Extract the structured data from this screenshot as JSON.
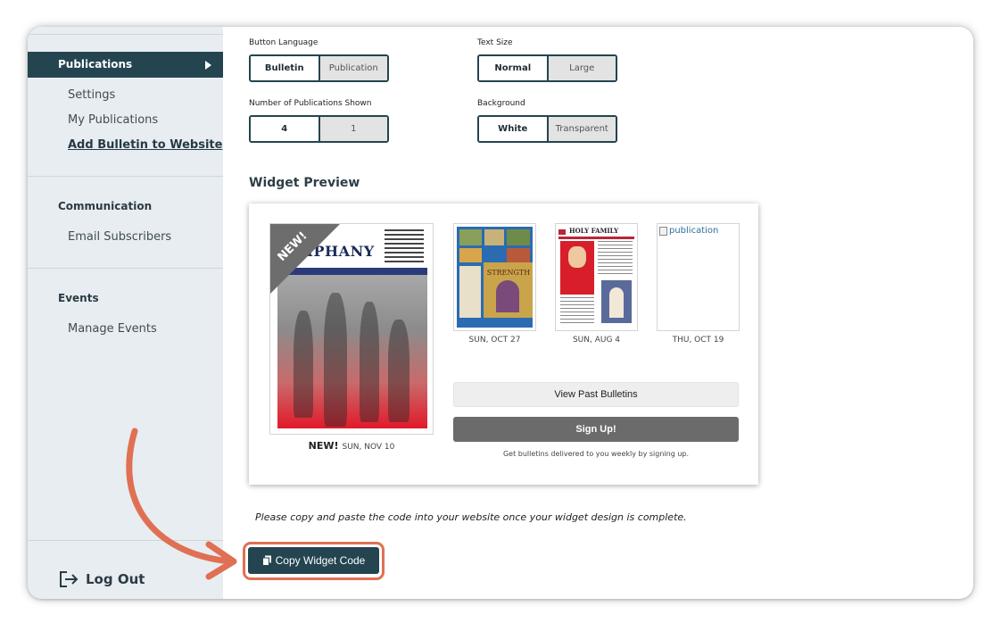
{
  "sidebar": {
    "active_section": "Publications",
    "publications_items": [
      "Settings",
      "My Publications",
      "Add Bulletin to Website"
    ],
    "communication_title": "Communication",
    "communication_items": [
      "Email Subscribers"
    ],
    "events_title": "Events",
    "events_items": [
      "Manage Events"
    ],
    "logout_label": "Log Out"
  },
  "settings": {
    "button_language": {
      "label": "Button Language",
      "options": [
        "Bulletin",
        "Publication"
      ],
      "selected": "Bulletin"
    },
    "text_size": {
      "label": "Text Size",
      "options": [
        "Normal",
        "Large"
      ],
      "selected": "Normal"
    },
    "num_publications": {
      "label": "Number of Publications Shown",
      "options": [
        "4",
        "1"
      ],
      "selected": "4"
    },
    "background": {
      "label": "Background",
      "options": [
        "White",
        "Transparent"
      ],
      "selected": "White"
    }
  },
  "preview": {
    "title": "Widget Preview",
    "featured": {
      "badge": "NEW!",
      "cover_title": "PIPHANY",
      "new_label": "NEW!",
      "date": "SUN, NOV 10"
    },
    "thumbnails": [
      {
        "date": "SUN, OCT 27",
        "cover_word": "STRENGTH"
      },
      {
        "date": "SUN, AUG 4",
        "cover_word": "HOLY FAMILY"
      },
      {
        "date": "THU, OCT 19",
        "alt_text": "publication"
      }
    ],
    "view_past_label": "View Past Bulletins",
    "signup_label": "Sign Up!",
    "signup_hint": "Get bulletins delivered to you weekly by signing up."
  },
  "instruction": "Please copy and paste the code into your website once your widget design is complete.",
  "copy_button_label": "Copy Widget Code",
  "colors": {
    "primary": "#244450",
    "annotation": "#e07053",
    "sidebar_bg": "#e8edf1"
  }
}
